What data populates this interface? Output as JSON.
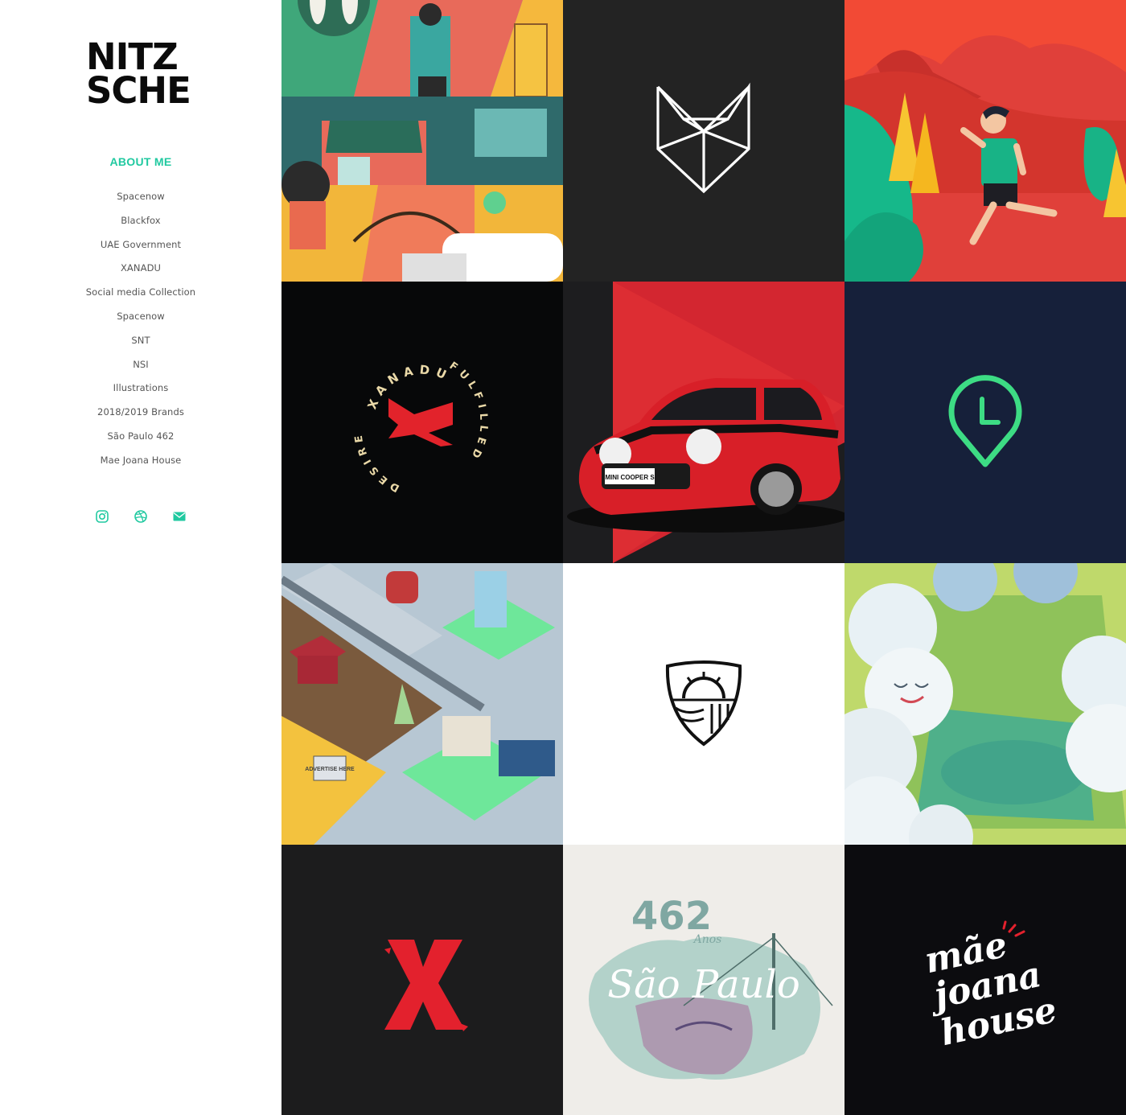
{
  "brand": {
    "line1": "NITZ",
    "line2": "SCHE"
  },
  "about_label": "ABOUT ME",
  "nav": [
    "Spacenow",
    "Blackfox",
    "UAE Government",
    "XANADU",
    "Social media Collection",
    "Spacenow",
    "SNT",
    "NSI",
    "Illustrations",
    "2018/2019 Brands",
    "São Paulo 462",
    "Mae Joana House"
  ],
  "social": [
    "instagram-icon",
    "dribbble-icon",
    "mail-icon"
  ],
  "colors": {
    "accent": "#20c9a0",
    "text": "#555555",
    "logo": "#0b0b0b"
  },
  "tiles": {
    "xanadu_ring_top": "XANADU",
    "xanadu_ring_right": "FULFILLED",
    "xanadu_ring_left": "DESIRE",
    "mini_plate": "MINI COOPER S",
    "city_sign": "ADVERTISE HERE",
    "sp_number": "462",
    "sp_anos": "Anos",
    "sp_title": "São Paulo",
    "mae_line1": "mãe",
    "mae_line2": "joana",
    "mae_line3": "house"
  }
}
